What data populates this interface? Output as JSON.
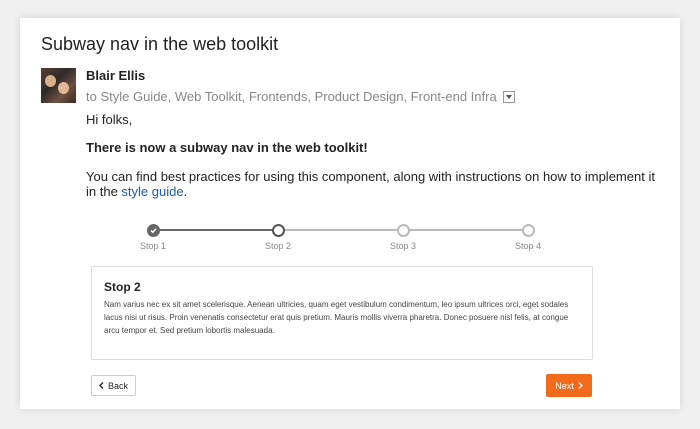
{
  "email": {
    "subject": "Subway nav in the web toolkit",
    "sender": "Blair Ellis",
    "recipients": "to Style Guide, Web Toolkit, Frontends, Product Design, Front-end Infra",
    "greeting": "Hi folks,",
    "headline": "There is now a subway nav in the web toolkit!",
    "body_before_link": "You can find best practices for using this component, along with instructions on how to implement it in the ",
    "link_text": "style guide",
    "body_after_link": "."
  },
  "subway": {
    "active_index": 1,
    "stops": [
      {
        "label": "Stop 1",
        "state": "complete"
      },
      {
        "label": "Stop 2",
        "state": "current"
      },
      {
        "label": "Stop 3",
        "state": "upcoming"
      },
      {
        "label": "Stop 4",
        "state": "upcoming"
      }
    ]
  },
  "panel": {
    "title": "Stop 2",
    "text": "Nam varius nec ex sit amet scelerisque. Aenean ultricies, quam eget vestibulum condimentum, leo ipsum ultrices orci, eget sodales lacus nisi ut risus. Proin venenatis consectetur erat quis pretium. Mauris mollis viverra pharetra. Donec posuere nisl felis, at congue arcu tempor et. Sed pretium lobortis malesuada."
  },
  "buttons": {
    "back_label": "Back",
    "next_label": "Next"
  },
  "colors": {
    "accent": "#f26b1d",
    "link": "#1a5da8",
    "track_done": "#666666",
    "track_todo": "#bbbbbb"
  },
  "icons": {
    "check": "check-icon",
    "back": "chevron-left-icon",
    "next": "chevron-right-icon",
    "dropdown": "chevron-down-icon"
  }
}
